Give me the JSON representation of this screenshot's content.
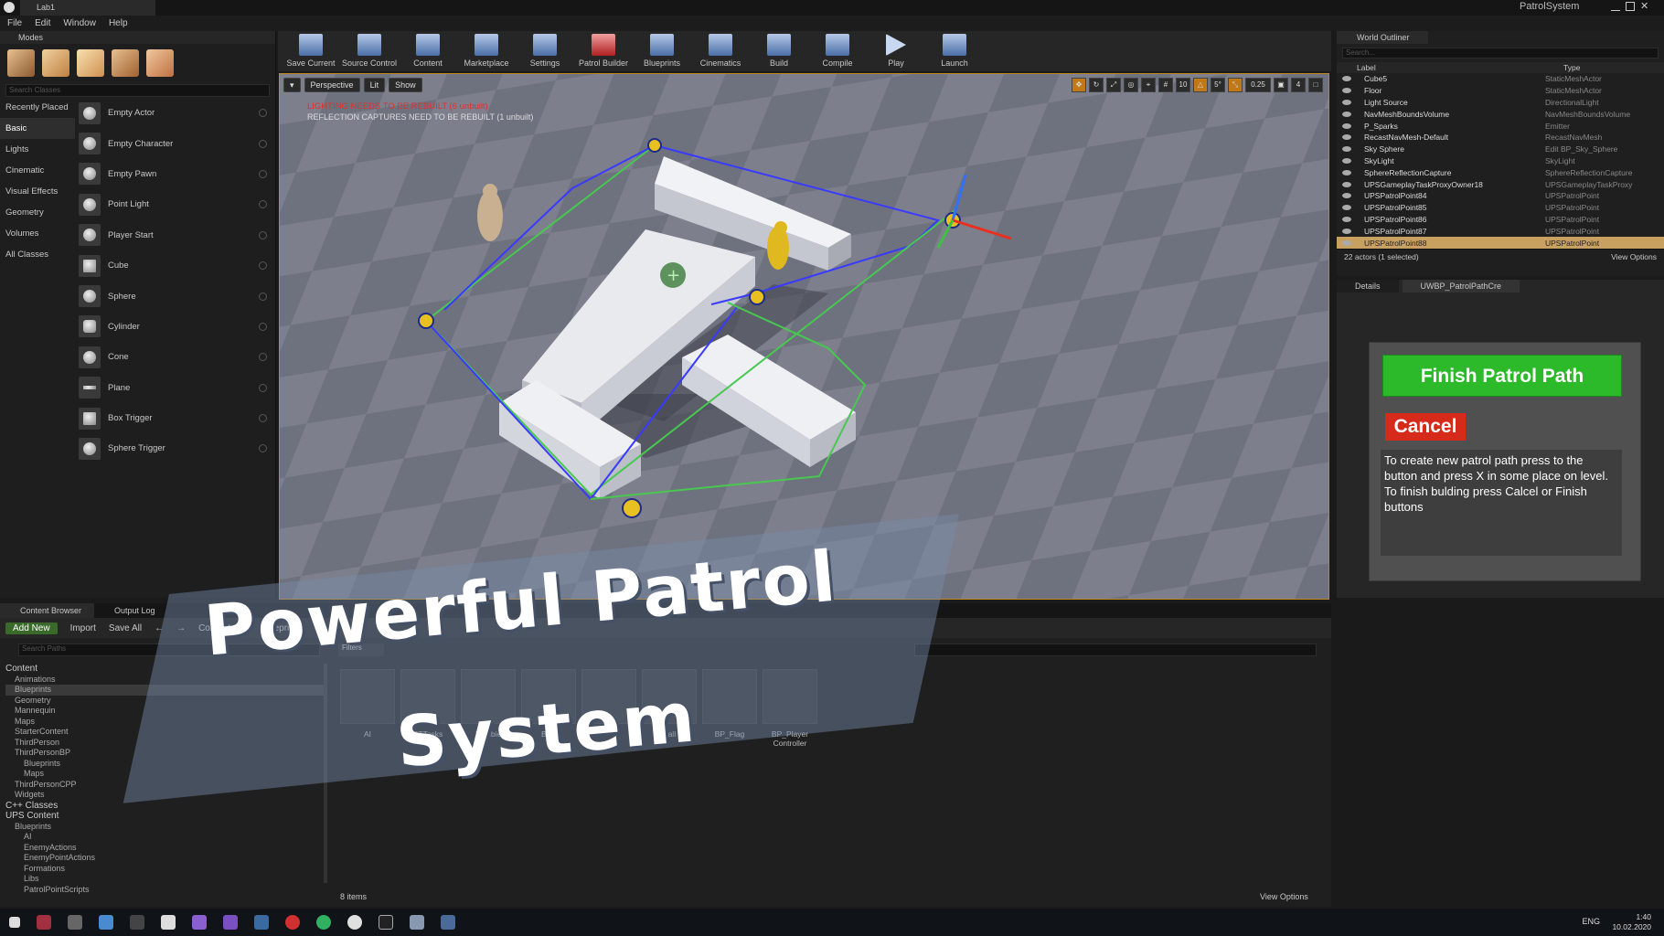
{
  "window": {
    "tab_title": "Lab1",
    "project_name": "PatrolSystem"
  },
  "menu": [
    "File",
    "Edit",
    "Window",
    "Help"
  ],
  "modes_panel": {
    "tab_label": "Modes",
    "search_placeholder": "Search Classes",
    "categories": [
      "Recently Placed",
      "Basic",
      "Lights",
      "Cinematic",
      "Visual Effects",
      "Geometry",
      "Volumes",
      "All Classes"
    ],
    "selected_category": "Basic",
    "items": [
      "Empty Actor",
      "Empty Character",
      "Empty Pawn",
      "Point Light",
      "Player Start",
      "Cube",
      "Sphere",
      "Cylinder",
      "Cone",
      "Plane",
      "Box Trigger",
      "Sphere Trigger"
    ]
  },
  "toolbar": [
    "Save Current",
    "Source Control",
    "Content",
    "Marketplace",
    "Settings",
    "Patrol Builder",
    "Blueprints",
    "Cinematics",
    "Build",
    "Compile",
    "Play",
    "Launch"
  ],
  "viewport": {
    "buttons": [
      "Perspective",
      "Lit",
      "Show"
    ],
    "warning1": "LIGHTING NEEDS TO BE REBUILT (6 unbuilt)",
    "warning2": "REFLECTION CAPTURES NEED TO BE REBUILT (1 unbuilt)",
    "snap_values": [
      "10",
      "5°",
      "0.25",
      "4"
    ]
  },
  "outliner": {
    "tab_label": "World Outliner",
    "search_placeholder": "Search...",
    "col_label": "Label",
    "col_type": "Type",
    "rows": [
      {
        "label": "Cube5",
        "type": "StaticMeshActor"
      },
      {
        "label": "Floor",
        "type": "StaticMeshActor"
      },
      {
        "label": "Light Source",
        "type": "DirectionalLight"
      },
      {
        "label": "NavMeshBoundsVolume",
        "type": "NavMeshBoundsVolume"
      },
      {
        "label": "P_Sparks",
        "type": "Emitter"
      },
      {
        "label": "RecastNavMesh-Default",
        "type": "RecastNavMesh"
      },
      {
        "label": "Sky Sphere",
        "type": "Edit BP_Sky_Sphere"
      },
      {
        "label": "SkyLight",
        "type": "SkyLight"
      },
      {
        "label": "SphereReflectionCapture",
        "type": "SphereReflectionCapture"
      },
      {
        "label": "UPSGameplayTaskProxyOwner18",
        "type": "UPSGameplayTaskProxy"
      },
      {
        "label": "UPSPatrolPoint84",
        "type": "UPSPatrolPoint"
      },
      {
        "label": "UPSPatrolPoint85",
        "type": "UPSPatrolPoint"
      },
      {
        "label": "UPSPatrolPoint86",
        "type": "UPSPatrolPoint"
      },
      {
        "label": "UPSPatrolPoint87",
        "type": "UPSPatrolPoint"
      },
      {
        "label": "UPSPatrolPoint88",
        "type": "UPSPatrolPoint"
      }
    ],
    "selected_row": "UPSPatrolPoint88",
    "footer": "22 actors (1 selected)",
    "view_options": "View Options"
  },
  "details": {
    "tabs": [
      "Details",
      "UWBP_PatrolPathCre"
    ],
    "finish_button": "Finish Patrol Path",
    "cancel_button": "Cancel",
    "help_text": "To create new patrol path press to the button and press X in some place on level. To finish bulding press Calcel or Finish buttons"
  },
  "content_browser": {
    "tabs": [
      "Content Browser",
      "Output Log"
    ],
    "toolbar": [
      "Add New",
      "Import",
      "Save All"
    ],
    "path": [
      "Content",
      "Blueprints"
    ],
    "filter_label": "Filters",
    "search_placeholder": "Search Paths",
    "tree": [
      "Content",
      "Animations",
      "Blueprints",
      "Geometry",
      "Mannequin",
      "Maps",
      "StarterContent",
      "ThirdPerson",
      "ThirdPersonBP",
      "Blueprints",
      "Maps",
      "ThirdPersonCPP",
      "Widgets",
      "C++ Classes",
      "UPS Content",
      "Blueprints",
      "AI",
      "EnemyActions",
      "EnemyPointActions",
      "Formations",
      "Libs",
      "PatrolPointScripts"
    ],
    "assets": [
      "AI",
      "BTTasks",
      "Zombie",
      "BP_",
      "",
      "Ball",
      "BP_Flag",
      "BP_Player Controller"
    ],
    "item_count": "8 items",
    "view_options": "View Options"
  },
  "overlay_title": {
    "line1": "Powerful Patrol",
    "line2": "System"
  },
  "taskbar": {
    "lang": "ENG",
    "time": "1:40",
    "date": "10.02.2020"
  }
}
